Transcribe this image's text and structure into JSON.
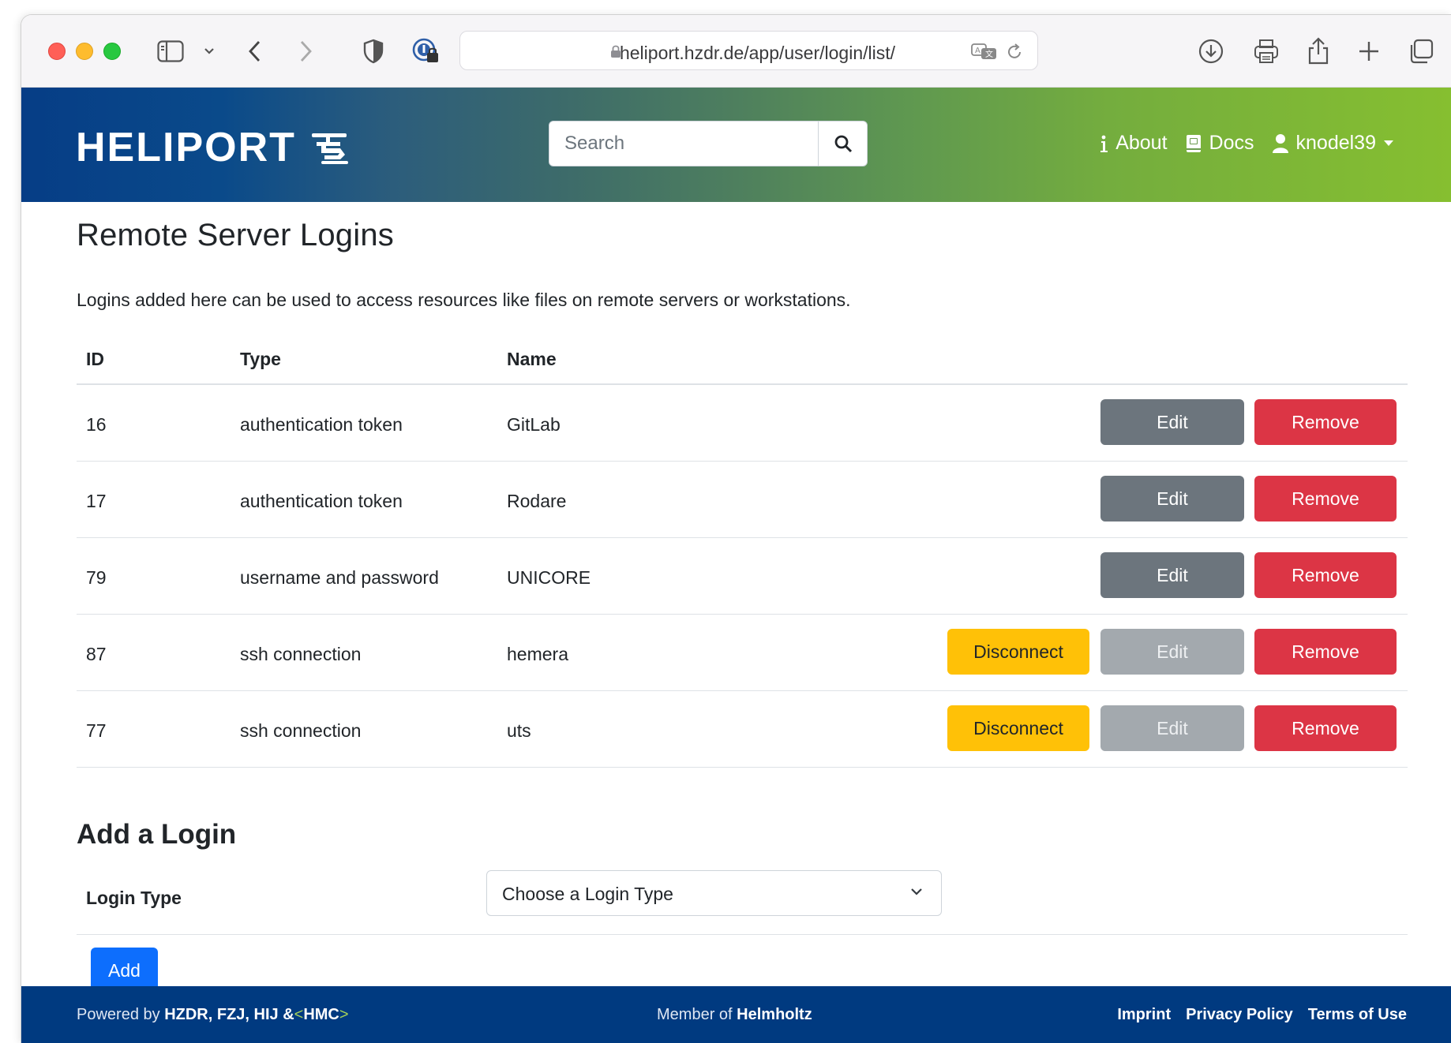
{
  "browser": {
    "url": "heliport.hzdr.de/app/user/login/list/"
  },
  "header": {
    "brand": "HELIPORT",
    "search_placeholder": "Search",
    "nav": {
      "about": "About",
      "docs": "Docs",
      "user": "knodel39"
    }
  },
  "page": {
    "title": "Remote Server Logins",
    "description": "Logins added here can be used to access resources like files on remote servers or workstations."
  },
  "table": {
    "headers": {
      "id": "ID",
      "type": "Type",
      "name": "Name"
    },
    "rows": [
      {
        "id": "16",
        "type": "authentication token",
        "name": "GitLab",
        "disconnect": "",
        "edit": "Edit",
        "remove": "Remove"
      },
      {
        "id": "17",
        "type": "authentication token",
        "name": "Rodare",
        "disconnect": "",
        "edit": "Edit",
        "remove": "Remove"
      },
      {
        "id": "79",
        "type": "username and password",
        "name": "UNICORE",
        "disconnect": "",
        "edit": "Edit",
        "remove": "Remove"
      },
      {
        "id": "87",
        "type": "ssh connection",
        "name": "hemera",
        "disconnect": "Disconnect",
        "edit": "Edit",
        "remove": "Remove"
      },
      {
        "id": "77",
        "type": "ssh connection",
        "name": "uts",
        "disconnect": "Disconnect",
        "edit": "Edit",
        "remove": "Remove"
      }
    ]
  },
  "add_form": {
    "title": "Add a Login",
    "label": "Login Type",
    "select_value": "Choose a Login Type",
    "add_button": "Add"
  },
  "footer": {
    "powered_prefix": "Powered by",
    "powered_orgs": "HZDR, FZJ, HIJ &",
    "hmc_open": "<",
    "hmc": "HMC",
    "hmc_close": ">",
    "member_prefix": "Member of",
    "member_org": "Helmholtz",
    "links": [
      "Imprint",
      "Privacy Policy",
      "Terms of Use"
    ]
  },
  "colors": {
    "edit": "#6c757d",
    "remove": "#dc3545",
    "disconnect": "#ffc107",
    "add": "#0d6efd",
    "footer": "#003a80"
  }
}
